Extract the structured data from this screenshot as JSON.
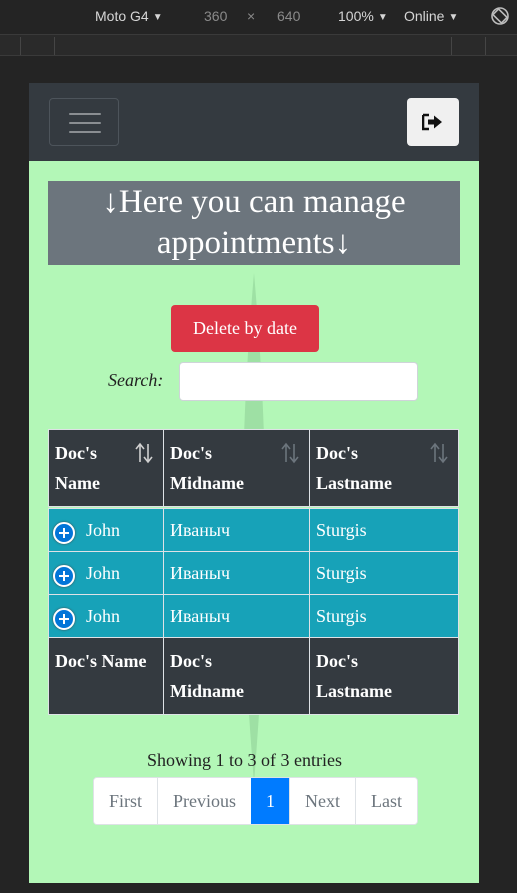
{
  "devtools": {
    "device": "Moto G4",
    "width": "360",
    "times": "×",
    "height": "640",
    "zoom": "100%",
    "network": "Online"
  },
  "app": {
    "heading_line1": "↓Here you can manage",
    "heading_line2": "appointments↓",
    "delete_button": "Delete by date",
    "search_label": "Search:",
    "search_value": "",
    "columns": [
      "Doc's Name",
      "Doc's Midname",
      "Doc's Lastname"
    ],
    "header_columns_wrapped": [
      [
        "Doc's",
        "Name"
      ],
      [
        "Doc's",
        "Midname"
      ],
      [
        "Doc's",
        "Lastname"
      ]
    ],
    "rows": [
      {
        "name": "John",
        "midname": "Иваныч",
        "lastname": "Sturgis"
      },
      {
        "name": "John",
        "midname": "Иваныч",
        "lastname": "Sturgis"
      },
      {
        "name": "John",
        "midname": "Иваныч",
        "lastname": "Sturgis"
      }
    ],
    "footer_columns": [
      [
        "Doc's Name"
      ],
      [
        "Doc's",
        "Midname"
      ],
      [
        "Doc's",
        "Lastname"
      ]
    ],
    "info": "Showing 1 to 3 of 3 entries",
    "pagination": [
      "First",
      "Previous",
      "1",
      "Next",
      "Last"
    ],
    "active_page": "1"
  },
  "colors": {
    "background": "#b3f7b7",
    "navbar": "#343a40",
    "danger": "#dc3545",
    "row": "#17a2b8",
    "active_page": "#007bff"
  }
}
